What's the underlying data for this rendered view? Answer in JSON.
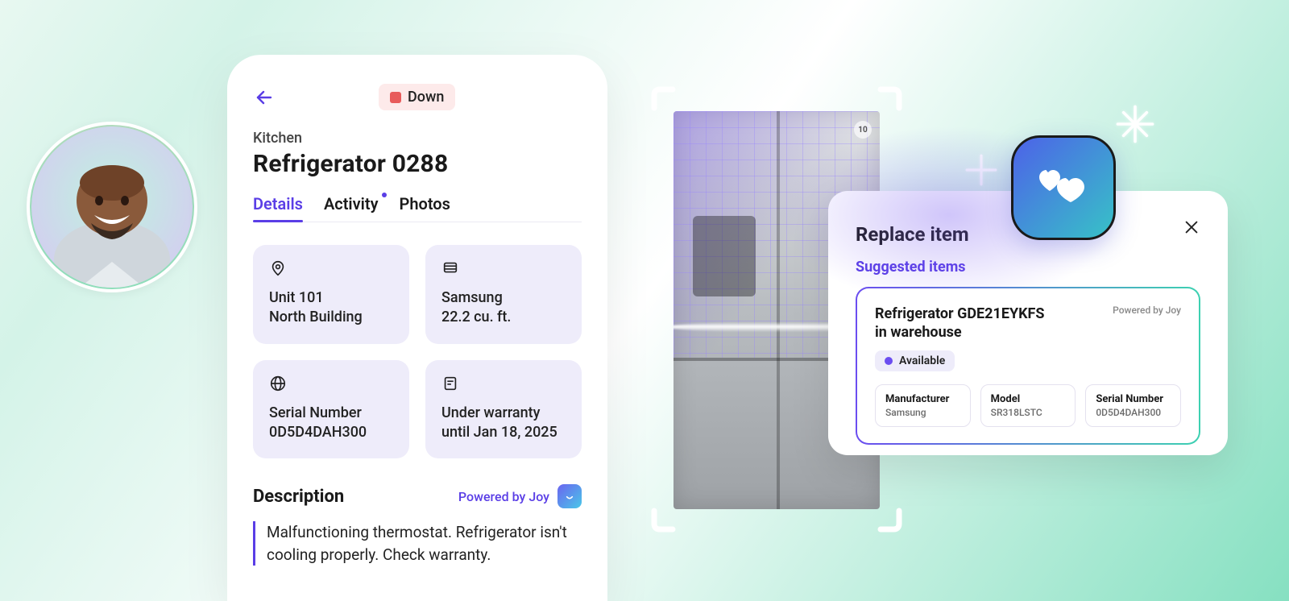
{
  "avatar": {
    "name": "user-avatar"
  },
  "phone": {
    "status": "Down",
    "breadcrumb": "Kitchen",
    "title": "Refrigerator 0288",
    "tabs": [
      {
        "label": "Details",
        "active": true
      },
      {
        "label": "Activity",
        "has_dot": true
      },
      {
        "label": "Photos"
      }
    ],
    "info_cards": {
      "location": {
        "line1": "Unit 101",
        "line2": "North Building",
        "icon": "pin-icon"
      },
      "spec": {
        "line1": "Samsung",
        "line2": "22.2 cu. ft.",
        "icon": "appliance-icon"
      },
      "serial": {
        "line1": "Serial Number",
        "line2": "0D5D4DAH300",
        "icon": "globe-icon"
      },
      "warranty": {
        "line1": "Under warranty",
        "line2": "until Jan 18, 2025",
        "icon": "receipt-icon"
      }
    },
    "description": {
      "heading": "Description",
      "powered_by": "Powered by Joy",
      "body": "Malfunctioning thermostat. Refrigerator isn't cooling properly. Check warranty."
    }
  },
  "fridge": {
    "badge": "10"
  },
  "replace_panel": {
    "title": "Replace item",
    "subtitle": "Suggested items",
    "close_label": "close",
    "card": {
      "name_line1": "Refrigerator GDE21EYKFS",
      "name_line2": "in warehouse",
      "powered_by": "Powered by Joy",
      "availability": "Available",
      "specs": {
        "manufacturer": {
          "label": "Manufacturer",
          "value": "Samsung"
        },
        "model": {
          "label": "Model",
          "value": "SR318LSTC"
        },
        "serial": {
          "label": "Serial Number",
          "value": "0D5D4DAH300"
        }
      }
    }
  }
}
